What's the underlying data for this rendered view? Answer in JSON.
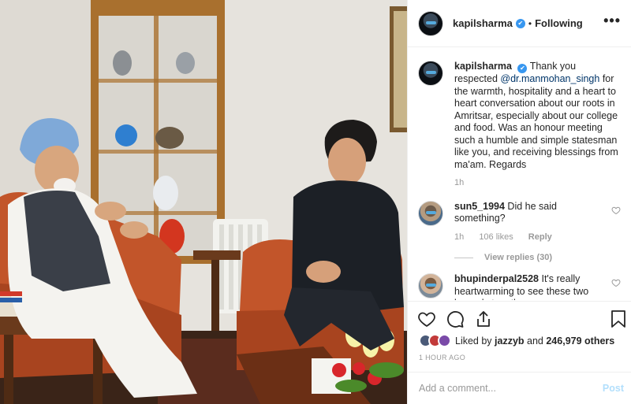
{
  "post": {
    "username": "kapilsharma",
    "verified_glyph": "✔",
    "dot": "•",
    "follow_status": "Following",
    "more_glyph": "•••",
    "caption": {
      "username": "kapilsharma",
      "text_before": "Thank you respected ",
      "mention": "@dr.manmohan_singh",
      "text_after": " for the warmth, hospitality and a heart to heart conversation about our roots in Amritsar, especially about our college and food. Was an honour meeting such a humble and simple statesman like you, and receiving blessings from ma'am. Regards ",
      "time": "1h"
    }
  },
  "comments": [
    {
      "username": "sun5_1994",
      "text": "Did he said something?",
      "time": "1h",
      "likes": "106 likes",
      "reply_label": "Reply",
      "view_replies": "View replies (30)"
    },
    {
      "username": "bhupinderpal2528",
      "text": "It's really heartwarming to see these two legends together"
    }
  ],
  "actions": {
    "like_icon": "heart-icon",
    "comment_icon": "comment-icon",
    "share_icon": "share-icon",
    "save_icon": "bookmark-icon"
  },
  "likes": {
    "prefix": "Liked by ",
    "first_user": "jazzyb",
    "middle": " and ",
    "others": "246,979 others"
  },
  "timestamp": "1 HOUR AGO",
  "add_comment": {
    "placeholder": "Add a comment...",
    "post_label": "Post"
  },
  "colors": {
    "link": "#003569",
    "verified": "#3897f0",
    "post_disabled": "#b2dffc",
    "muted": "#999999"
  }
}
